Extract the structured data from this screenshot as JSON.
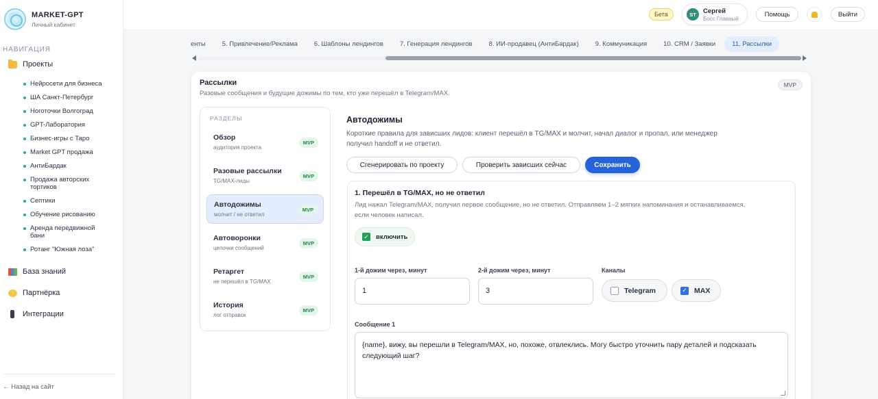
{
  "brand": {
    "name": "MARKET-GPT",
    "subtitle": "Личный кабинет"
  },
  "nav": {
    "title": "НАВИГАЦИЯ",
    "projects_label": "Проекты",
    "projects": [
      "Нейросети для бизнеса",
      "ША Санкт-Петербург",
      "Ноготочки Волгоград",
      "GPT-Лаборатория",
      "Бизнес-игры с Таро",
      "Market GPT продажа",
      "АнтиБардак",
      "Продажа авторских тортиков",
      "Септики",
      "Обучение рисованию",
      "Аренда передвижной бани",
      "Ротанг \"Южная лоза\""
    ],
    "knowledge_label": "База знаний",
    "partner_label": "Партнёрка",
    "integrations_label": "Интеграции",
    "back_label": "← Назад на сайт"
  },
  "topbar": {
    "beta": "Бета",
    "user_initials": "ST",
    "user_name": "Сергей",
    "user_role": "Босс Главный",
    "help": "Помощь",
    "logout": "Выйти"
  },
  "tabs": [
    {
      "label": "енты"
    },
    {
      "label": "5. Привлечение/Реклама"
    },
    {
      "label": "6. Шаблоны лендингов"
    },
    {
      "label": "7. Генерация лендингов"
    },
    {
      "label": "8. ИИ-продавец (АнтиБардак)"
    },
    {
      "label": "9. Коммуникация"
    },
    {
      "label": "10. CRM / Заявки"
    },
    {
      "label": "11. Рассылки"
    }
  ],
  "card": {
    "title": "Рассылки",
    "subtitle": "Разовые сообщения и будущие дожимы по тем, кто уже перешёл в Telegram/MAX.",
    "badge": "MVP"
  },
  "sections": {
    "title": "РАЗДЕЛЫ",
    "items": [
      {
        "name": "Обзор",
        "sub": "аудитория проекта",
        "badge": "MVP"
      },
      {
        "name": "Разовые рассылки",
        "sub": "TG/MAX-лиды",
        "badge": "MVP"
      },
      {
        "name": "Автодожимы",
        "sub": "молчит / не ответил",
        "badge": "MVP"
      },
      {
        "name": "Автоворонки",
        "sub": "цепочки сообщений",
        "badge": "MVP"
      },
      {
        "name": "Ретаргет",
        "sub": "не перешёл в TG/MAX",
        "badge": "MVP"
      },
      {
        "name": "История",
        "sub": "лог отправок",
        "badge": "MVP"
      }
    ]
  },
  "content": {
    "title": "Автодожимы",
    "description": "Короткие правила для зависших лидов: клиент перешёл в TG/MAX и молчит, начал диалог и пропал, или менеджер получил handoff и не ответил.",
    "btn_generate": "Сгенерировать по проекту",
    "btn_check": "Проверить зависших сейчас",
    "btn_save": "Сохранить",
    "rule": {
      "title": "1. Перешёл в TG/MAX, но не ответил",
      "description": "Лид нажал Telegram/MAX, получил первое сообщение, но не ответил. Отправляем 1–2 мягких напоминания и останавливаемся, если человек написал.",
      "enable_label": "включить",
      "first_label": "1-й дожим через, минут",
      "first_value": "1",
      "second_label": "2-й дожим через, минут",
      "second_value": "3",
      "channels_label": "Каналы",
      "channel_telegram": "Telegram",
      "channel_max": "MAX",
      "message_label": "Сообщение 1",
      "message_text": "{name}, вижу, вы перешли в Telegram/MAX, но, похоже, отвлеклись. Могу быстро уточнить пару деталей и подсказать следующий шаг?"
    }
  },
  "colors": {
    "accent": "#2563d9",
    "status_green": "#22a05a",
    "active_bg": "#e3edfb"
  }
}
